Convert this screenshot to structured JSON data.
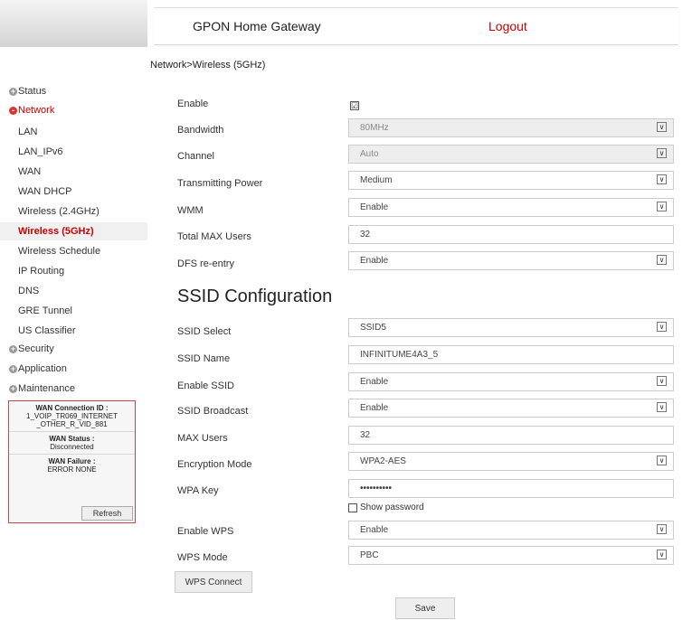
{
  "header": {
    "title": "GPON Home Gateway",
    "logout": "Logout"
  },
  "breadcrumb": "Network>Wireless (5GHz)",
  "sidebar": {
    "cat_status": "Status",
    "cat_network": "Network",
    "items": [
      "LAN",
      "LAN_IPv6",
      "WAN",
      "WAN DHCP",
      "Wireless (2.4GHz)",
      "Wireless (5GHz)",
      "Wireless Schedule",
      "IP Routing",
      "DNS",
      "GRE Tunnel",
      "US Classifier"
    ],
    "cat_security": "Security",
    "cat_application": "Application",
    "cat_maintenance": "Maintenance",
    "expand_symbol": "+",
    "collapse_symbol": "-"
  },
  "status_box": {
    "conn_title": "WAN Connection ID :",
    "conn_value": "1_VOIP_TR069_INTERNET _OTHER_R_VID_881",
    "status_title": "WAN Status :",
    "status_value": "Disconnected",
    "failure_title": "WAN Failure :",
    "failure_value": "ERROR NONE",
    "refresh": "Refresh"
  },
  "form": {
    "enable_label": "Enable",
    "bandwidth_label": "Bandwidth",
    "bandwidth_value": "80MHz",
    "channel_label": "Channel",
    "channel_value": "Auto",
    "txpower_label": "Transmitting Power",
    "txpower_value": "Medium",
    "wmm_label": "WMM",
    "wmm_value": "Enable",
    "maxusers_label": "Total MAX Users",
    "maxusers_value": "32",
    "dfs_label": "DFS re-entry",
    "dfs_value": "Enable"
  },
  "ssid": {
    "heading": "SSID Configuration",
    "select_label": "SSID Select",
    "select_value": "SSID5",
    "name_label": "SSID Name",
    "name_value": "INFINITUME4A3_5",
    "enable_label": "Enable SSID",
    "enable_value": "Enable",
    "broadcast_label": "SSID Broadcast",
    "broadcast_value": "Enable",
    "maxusers_label": "MAX Users",
    "maxusers_value": "32",
    "enc_label": "Encryption Mode",
    "enc_value": "WPA2-AES",
    "wpakey_label": "WPA Key",
    "wpakey_value": "••••••••••",
    "showpw_label": "Show password",
    "wps_label": "Enable WPS",
    "wps_value": "Enable",
    "wpsmode_label": "WPS Mode",
    "wpsmode_value": "PBC",
    "wps_connect": "WPS Connect",
    "save": "Save"
  },
  "icons": {
    "checkmark": "☑",
    "dropdown": "∨"
  }
}
